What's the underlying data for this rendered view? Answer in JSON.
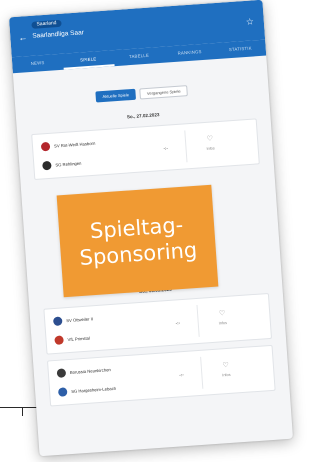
{
  "header": {
    "league_pill": "Saarland",
    "title": "Saarlandliga Saar",
    "back_icon": "arrow-left-icon",
    "star_icon": "star-icon"
  },
  "tabs": [
    {
      "label": "NEWS",
      "active": false
    },
    {
      "label": "SPIELE",
      "active": true
    },
    {
      "label": "TABELLE",
      "active": false
    },
    {
      "label": "RANKINGS",
      "active": false
    },
    {
      "label": "STATISTIK",
      "active": false
    }
  ],
  "toggle": {
    "option_a": "Aktuelle Spiele",
    "option_b": "Vergangene Spiele"
  },
  "matchdays": [
    {
      "date": "So., 27.02.2023",
      "matches": [
        {
          "home": "SV Rot-Weiß Hasborn",
          "away": "SG Rehlingen",
          "score": "-:-",
          "info_label": "Infos",
          "home_crest_color": "#b3262c",
          "away_crest_color": "#2b2b2b"
        }
      ]
    },
    {
      "date": "So., 06.03.2023",
      "matches": [
        {
          "home": "SV Ottweiler II",
          "away": "VfL Primstal",
          "score": "-:-",
          "info_label": "Infos",
          "home_crest_color": "#2c4e8f",
          "away_crest_color": "#c0392b"
        },
        {
          "home": "Borussia Neunkirchen",
          "away": "SG Hargesheim-Lebach",
          "score": "-:-",
          "info_label": "Infos",
          "home_crest_color": "#3a3a3a",
          "away_crest_color": "#2d5fa8"
        }
      ]
    }
  ],
  "sponsor": {
    "line1": "Spieltag-",
    "line2": "Sponsoring",
    "color": "#f09a33"
  }
}
